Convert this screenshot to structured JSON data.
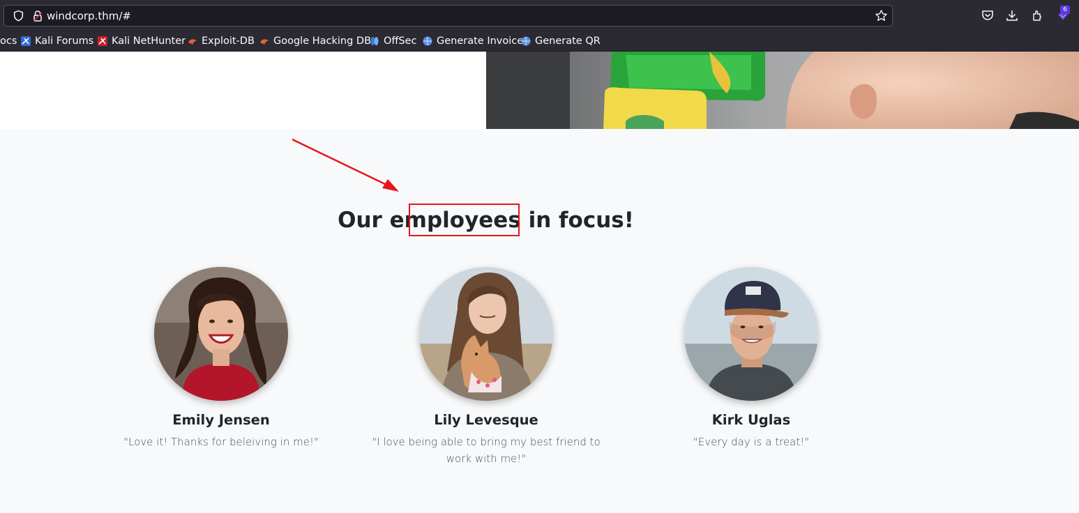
{
  "browser": {
    "url": "windcorp.thm/#",
    "extension_badge": "6",
    "bookmarks": [
      {
        "label": "ocs",
        "icon": "docs-icon"
      },
      {
        "label": "Kali Forums",
        "icon": "kali-forums-icon"
      },
      {
        "label": "Kali NetHunter",
        "icon": "kali-nethunter-icon"
      },
      {
        "label": "Exploit-DB",
        "icon": "exploit-db-icon"
      },
      {
        "label": "Google Hacking DB",
        "icon": "ghdb-icon"
      },
      {
        "label": "OffSec",
        "icon": "offsec-icon"
      },
      {
        "label": "Generate Invoice",
        "icon": "globe-icon"
      },
      {
        "label": "Generate QR",
        "icon": "globe-icon"
      }
    ]
  },
  "section": {
    "heading_before": "Our ",
    "heading_highlight": "employees",
    "heading_after": " in focus!",
    "employees": [
      {
        "name": "Emily Jensen",
        "quote": "\"Love it! Thanks for beleiving in me!\""
      },
      {
        "name": "Lily Levesque",
        "quote": "\"I love being able to bring my best friend to work with me!\""
      },
      {
        "name": "Kirk Uglas",
        "quote": "\"Every day is a treat!\""
      }
    ]
  },
  "colors": {
    "annotation": "#e8141c",
    "browser_chrome": "#2b2a33",
    "section_background": "#f8f9fa"
  }
}
